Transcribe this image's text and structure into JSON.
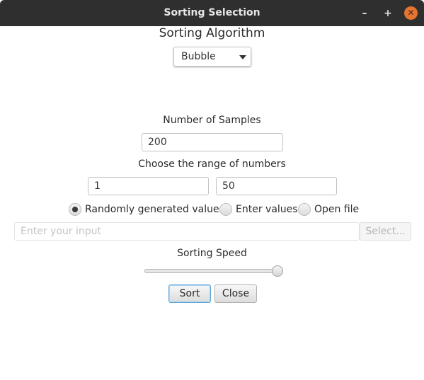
{
  "window": {
    "title": "Sorting Selection",
    "controls": {
      "minimize": "–",
      "maximize": "+",
      "close": "✕"
    }
  },
  "algorithm": {
    "heading": "Sorting Algorithm",
    "selected": "Bubble"
  },
  "samples": {
    "label": "Number of Samples",
    "value": "200"
  },
  "range": {
    "label": "Choose the range of numbers",
    "min": "1",
    "max": "50"
  },
  "input_mode": {
    "options": [
      {
        "label": "Randomly generated values",
        "selected": true
      },
      {
        "label": "Enter values",
        "selected": false
      },
      {
        "label": "Open file",
        "selected": false
      }
    ]
  },
  "manual_input": {
    "placeholder": "Enter your input",
    "select_label": "Select..."
  },
  "speed": {
    "label": "Sorting Speed",
    "level": 1.0
  },
  "actions": {
    "sort_label": "Sort",
    "close_label": "Close"
  },
  "colors": {
    "titlebar": "#2f2f2f",
    "close_button": "#e5742f",
    "focus": "#5fa6d6"
  }
}
